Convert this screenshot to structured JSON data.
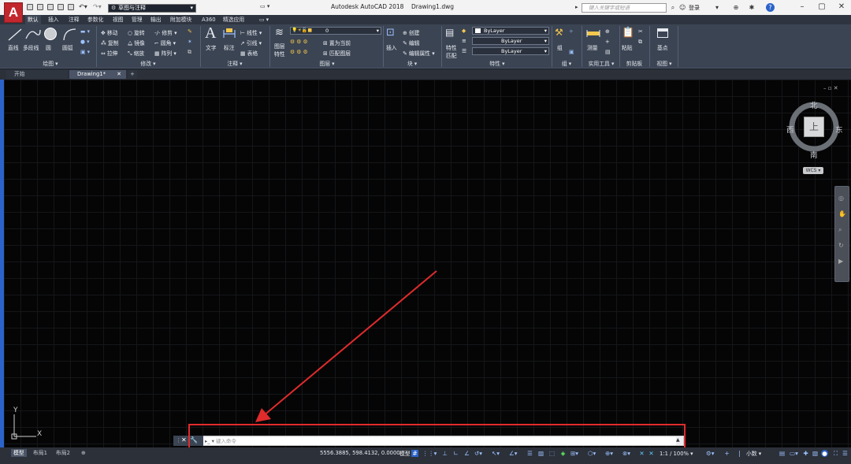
{
  "app": {
    "logo_letter": "A",
    "title": "Autodesk AutoCAD 2018",
    "document_name": "Drawing1.dwg",
    "workspace": "草图与注释",
    "search_placeholder": "键入关键字或短语",
    "login_label": "登录"
  },
  "ribbon_tabs": [
    "默认",
    "插入",
    "注释",
    "参数化",
    "视图",
    "管理",
    "输出",
    "附加模块",
    "A360",
    "精选应用"
  ],
  "ribbon": {
    "draw": {
      "line": "直线",
      "polyline": "多段线",
      "circle": "圆",
      "arc": "圆弧",
      "panel": "绘图 ▾"
    },
    "modify": {
      "move": "移动",
      "rotate": "旋转",
      "trim": "修剪",
      "copy": "复制",
      "mirror": "镜像",
      "fillet": "圆角",
      "stretch": "拉伸",
      "scale": "缩放",
      "array": "阵列",
      "panel": "修改 ▾"
    },
    "annotation": {
      "text": "文字",
      "dimension": "标注",
      "linear": "线性",
      "leader": "引线",
      "table": "表格",
      "panel": "注释 ▾"
    },
    "layers": {
      "properties_line1": "图层",
      "properties_line2": "特性",
      "current_layer": "0",
      "make_current": "置为当前",
      "match_layer": "匹配图层",
      "panel": "图层 ▾"
    },
    "block": {
      "insert": "插入",
      "create": "创建",
      "edit": "编辑",
      "edit_attributes": "编辑属性 ▾",
      "panel": "块 ▾"
    },
    "properties": {
      "match_line1": "特性",
      "match_line2": "匹配",
      "color": "ByLayer",
      "linetype": "ByLayer",
      "lineweight": "ByLayer",
      "panel": "特性 ▾"
    },
    "groups": {
      "group": "组",
      "panel": "组 ▾"
    },
    "utilities": {
      "measure": "测量",
      "panel": "实用工具 ▾"
    },
    "clipboard": {
      "paste": "粘贴",
      "panel": "剪贴板"
    },
    "view": {
      "base": "基点",
      "panel": "视图 ▾"
    }
  },
  "doc_tabs": {
    "start": "开始",
    "drawing": "Drawing1*",
    "add": "+"
  },
  "viewcube": {
    "north": "北",
    "south": "南",
    "east": "东",
    "west": "西",
    "face": "上",
    "wcs": "WCS"
  },
  "ucs": {
    "x": "X",
    "y": "Y"
  },
  "command_line": {
    "prompt": "键入命令"
  },
  "status": {
    "layout_tabs": [
      "模型",
      "布局1",
      "布局2"
    ],
    "coordinates": "5556.3885, 598.4132, 0.0000",
    "model_label": "模型",
    "annotation_scale": "1:1 / 100%",
    "units": "小数"
  },
  "colors": {
    "accent": "#c1272d",
    "highlight": "#e02b2b",
    "canvas": "#050506",
    "ribbon": "#3b4453"
  }
}
